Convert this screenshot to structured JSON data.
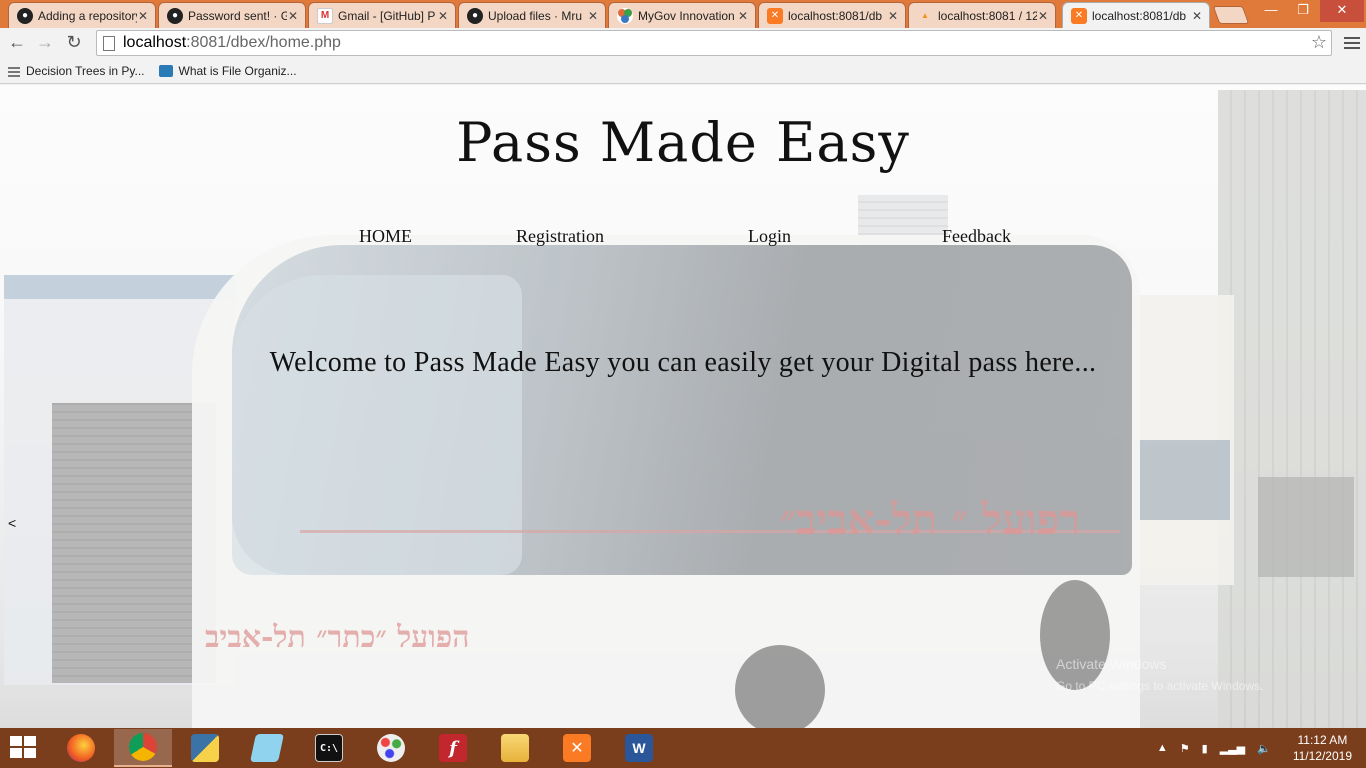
{
  "browser": {
    "tabs": [
      {
        "title": "Adding a repository",
        "icon": "github-icon",
        "active": false
      },
      {
        "title": "Password sent! · G",
        "icon": "github-icon",
        "active": false
      },
      {
        "title": "Gmail - [GitHub] P",
        "icon": "gmail-icon",
        "active": false
      },
      {
        "title": "Upload files · Mru",
        "icon": "github-icon",
        "active": false
      },
      {
        "title": "MyGov Innovation",
        "icon": "mygov-icon",
        "active": false
      },
      {
        "title": "localhost:8081/db",
        "icon": "xampp-icon",
        "active": false
      },
      {
        "title": "localhost:8081 / 12",
        "icon": "phpmyadmin-icon",
        "active": false
      },
      {
        "title": "localhost:8081/db",
        "icon": "xampp-icon",
        "active": true
      }
    ],
    "url_host": "localhost",
    "url_rest": ":8081/dbex/home.php",
    "bookmarks": [
      {
        "label": "Decision Trees in Py...",
        "icon": "apps-icon"
      },
      {
        "label": "What is File Organiz...",
        "icon": "page-icon"
      }
    ]
  },
  "site": {
    "title": "Pass Made Easy",
    "nav": {
      "home": "HOME",
      "registration": "Registration",
      "login": "Login",
      "feedback": "Feedback"
    },
    "welcome": "Welcome to Pass Made Easy you can easily get your Digital pass here...",
    "carousel_prev": "<",
    "watermark_line1": "Activate Windows",
    "watermark_line2": "Go to PC settings to activate Windows."
  },
  "taskbar": {
    "apps": [
      {
        "name": "firefox",
        "icon": "firefox-icon",
        "active": false
      },
      {
        "name": "chrome",
        "icon": "chrome-icon",
        "active": true
      },
      {
        "name": "python",
        "icon": "python-icon",
        "active": false
      },
      {
        "name": "notepad",
        "icon": "notepad-icon",
        "active": false
      },
      {
        "name": "cmd",
        "icon": "cmd-icon",
        "active": false
      },
      {
        "name": "paint",
        "icon": "paint-icon",
        "active": false
      },
      {
        "name": "flash",
        "icon": "flash-icon",
        "active": false
      },
      {
        "name": "explorer",
        "icon": "folder-icon",
        "active": false
      },
      {
        "name": "xampp",
        "icon": "xampp-icon",
        "active": false
      },
      {
        "name": "word",
        "icon": "word-icon",
        "active": false
      }
    ],
    "time": "11:12 AM",
    "date": "11/12/2019"
  },
  "colors": {
    "tab_strip": "#e07a3b",
    "taskbar": "#7a3e1c",
    "title_text": "#111111"
  }
}
